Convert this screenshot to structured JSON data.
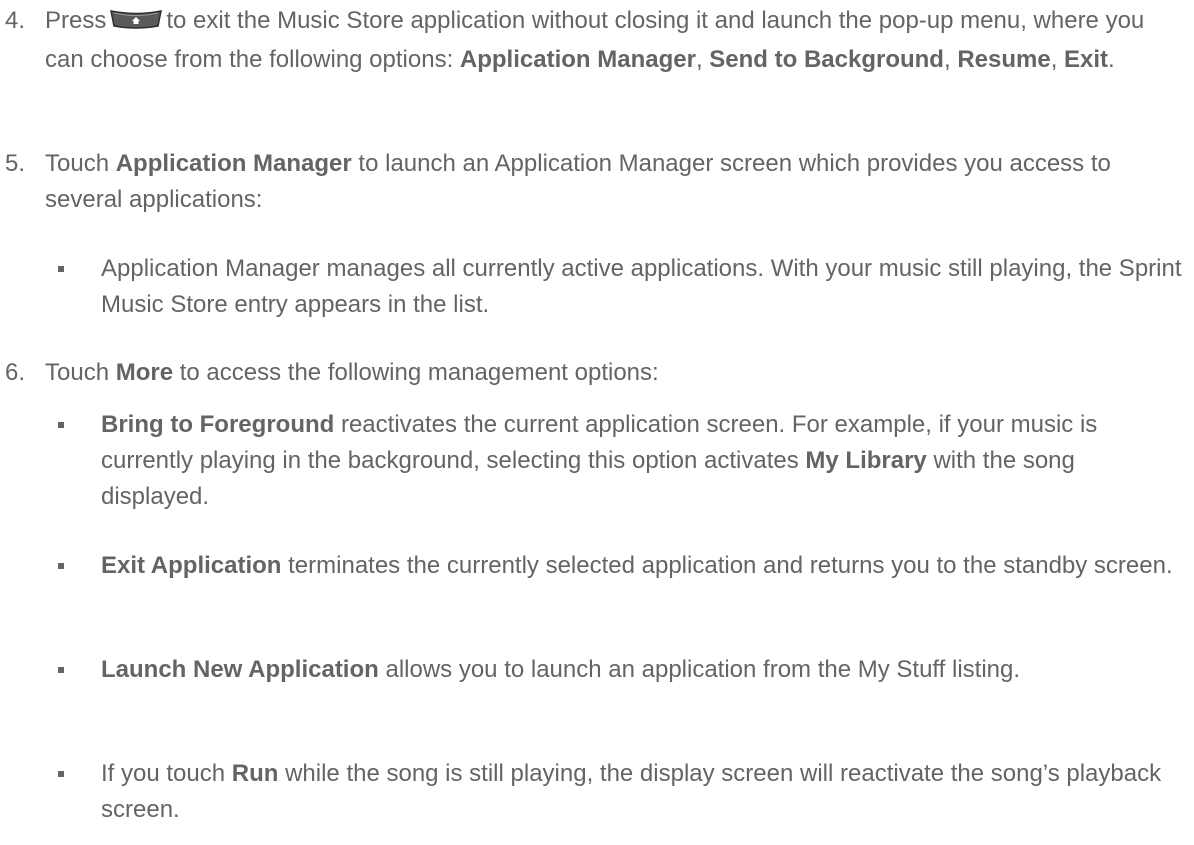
{
  "steps": [
    {
      "number": "4.",
      "t1": "Press",
      "t2": "to exit the Music Store application without closing it and launch the pop-up menu, where you can choose from the following options:",
      "o1": "Application Manager",
      "c1": ",",
      "o2": "Send to Background",
      "c2": ",",
      "o3": "Resume",
      "c3": ",",
      "o4": "Exit",
      "end": "."
    },
    {
      "number": "5.",
      "t1": "Touch",
      "b1": "Application Manager",
      "t2": "to launch an Application Manager screen which provides you access to several applications:"
    },
    {
      "number": "6.",
      "t1": "Touch",
      "b1": "More",
      "t2": "to access the following management options:"
    }
  ],
  "bullets": [
    {
      "text": "Application Manager manages all currently active applications. With your music still playing, the Sprint Music Store entry appears in the list."
    },
    {
      "b1": "Bring to Foreground",
      "t1": "reactivates the current application screen. For example, if your music is currently playing in the background, selecting this option activates",
      "b2": "My Library",
      "t2": "with the song displayed."
    },
    {
      "b1": "Exit Application",
      "t1": "terminates the currently selected application and returns you to the standby screen."
    },
    {
      "b1": "Launch New Application",
      "t1": "allows you to launch an application from the My Stuff listing."
    },
    {
      "t1": "If you touch",
      "b1": "Run",
      "t2": "while the song is still playing, the display screen will reactivate the song’s playback screen."
    }
  ],
  "icons": {
    "home_key": "home-key-icon"
  },
  "colors": {
    "text": "#636466"
  }
}
